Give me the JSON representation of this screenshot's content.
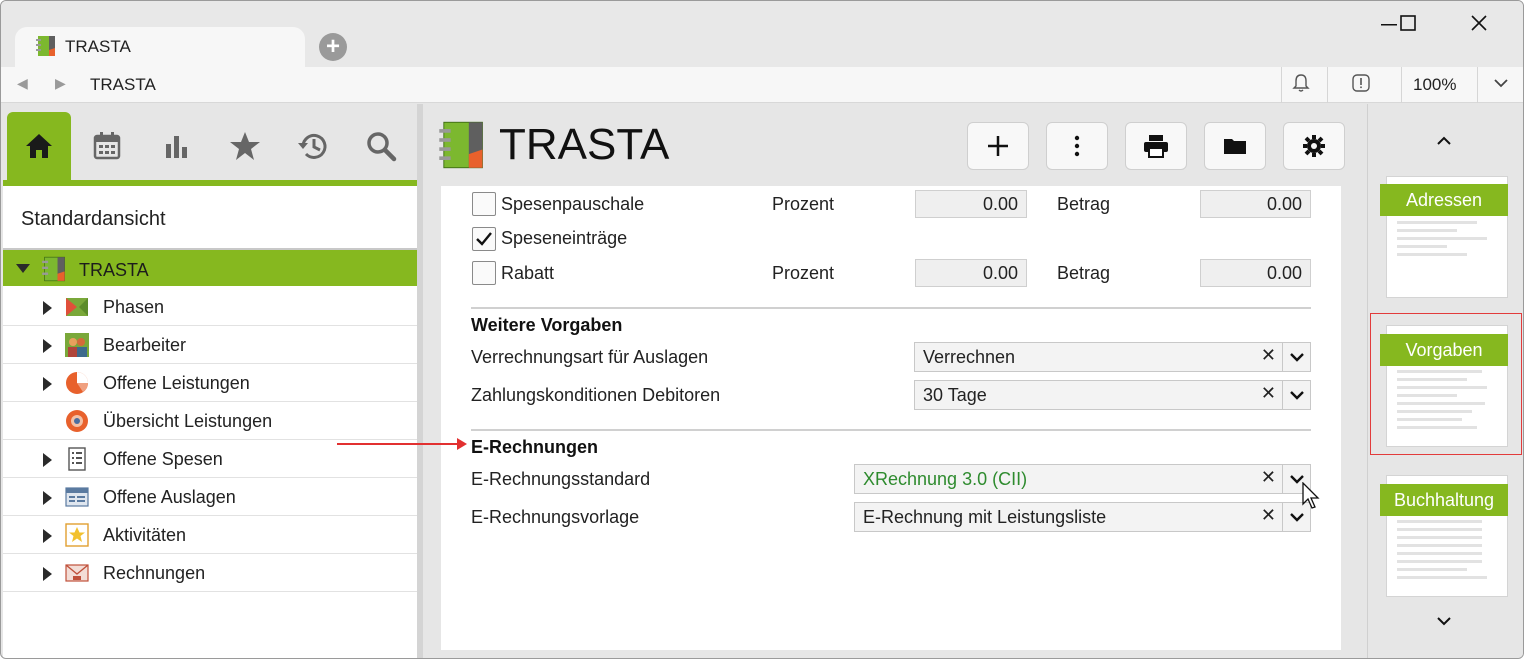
{
  "window": {
    "tab_title": "TRASTA",
    "new_tab_icon": "plus-circle-icon",
    "controls": [
      "minimize-icon",
      "maximize-icon",
      "close-icon"
    ]
  },
  "address_bar": {
    "text": "TRASTA",
    "zoom": "100%"
  },
  "left_panel": {
    "tools": [
      "home-icon",
      "calendar-icon",
      "chart-icon",
      "star-icon",
      "history-icon",
      "search-icon"
    ],
    "view_title": "Standardansicht",
    "tree_root": "TRASTA",
    "tree_items": [
      {
        "label": "Phasen",
        "expandable": true,
        "icon": "phases-icon"
      },
      {
        "label": "Bearbeiter",
        "expandable": true,
        "icon": "users-icon"
      },
      {
        "label": "Offene Leistungen",
        "expandable": true,
        "icon": "pie-icon"
      },
      {
        "label": "Übersicht Leistungen",
        "expandable": false,
        "icon": "overview-icon"
      },
      {
        "label": "Offene Spesen",
        "expandable": true,
        "icon": "receipt-icon"
      },
      {
        "label": "Offene Auslagen",
        "expandable": true,
        "icon": "expenses-icon"
      },
      {
        "label": "Aktivitäten",
        "expandable": true,
        "icon": "activity-star-icon"
      },
      {
        "label": "Rechnungen",
        "expandable": true,
        "icon": "invoice-icon"
      }
    ]
  },
  "main": {
    "title": "TRASTA",
    "toolbar": [
      "add-icon",
      "more-icon",
      "print-icon",
      "folder-icon",
      "settings-icon"
    ],
    "rows": {
      "spesenpauschale": {
        "label": "Spesenpauschale",
        "checked": false,
        "prozent_label": "Prozent",
        "prozent": "0.00",
        "betrag_label": "Betrag",
        "betrag": "0.00"
      },
      "speseneintraege": {
        "label": "Speseneinträge",
        "checked": true
      },
      "rabatt": {
        "label": "Rabatt",
        "checked": false,
        "prozent_label": "Prozent",
        "prozent": "0.00",
        "betrag_label": "Betrag",
        "betrag": "0.00"
      }
    },
    "weitere": {
      "heading": "Weitere Vorgaben",
      "verrechnungsart_label": "Verrechnungsart für Auslagen",
      "verrechnungsart_value": "Verrechnen",
      "zahlung_label": "Zahlungskonditionen Debitoren",
      "zahlung_value": "30 Tage"
    },
    "erechnungen": {
      "heading": "E-Rechnungen",
      "standard_label": "E-Rechnungsstandard",
      "standard_value": "XRechnung 3.0 (CII)",
      "standard_color": "#2e8b2e",
      "vorlage_label": "E-Rechnungsvorlage",
      "vorlage_value": "E-Rechnung mit Leistungsliste"
    },
    "clear_glyph": "✕"
  },
  "right_panel": {
    "thumbnails": [
      "Adressen",
      "Vorgaben",
      "Buchhaltung"
    ],
    "selected": "Vorgaben"
  },
  "colors": {
    "accent": "#86b81f",
    "annotation": "#e23030"
  }
}
